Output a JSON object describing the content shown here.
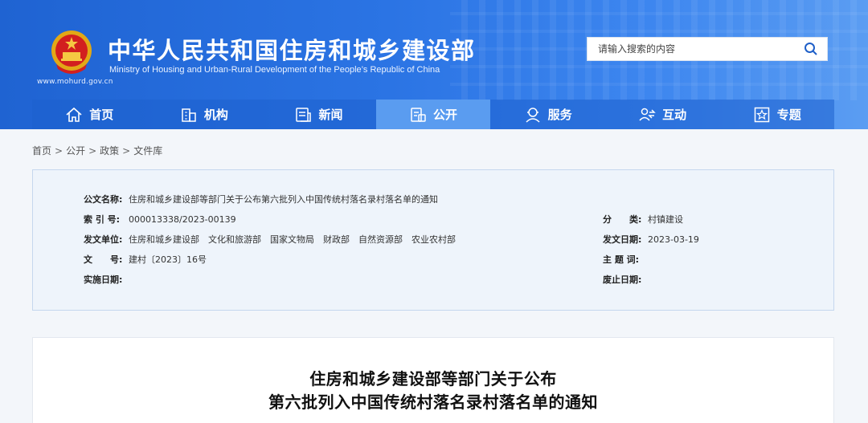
{
  "header": {
    "title_cn": "中华人民共和国住房和城乡建设部",
    "title_en": "Ministry of Housing and Urban-Rural Development of the People’s Republic of China",
    "url": "www.mohurd.gov.cn",
    "search_placeholder": "请输入搜索的内容",
    "brand_blue": "#2b74e4"
  },
  "nav": {
    "items": [
      {
        "label": "首页",
        "icon": "home-icon"
      },
      {
        "label": "机构",
        "icon": "building-icon"
      },
      {
        "label": "新闻",
        "icon": "news-icon"
      },
      {
        "label": "公开",
        "icon": "open-document-icon"
      },
      {
        "label": "服务",
        "icon": "service-icon"
      },
      {
        "label": "互动",
        "icon": "interaction-icon"
      },
      {
        "label": "专题",
        "icon": "topic-star-icon"
      }
    ],
    "active_index": 3
  },
  "breadcrumb": [
    "首页",
    "公开",
    "政策",
    "文件库"
  ],
  "info": {
    "doc_name_label": "公文名称:",
    "doc_name": "住房和城乡建设部等部门关于公布第六批列入中国传统村落名录村落名单的通知",
    "index_label": "索 引 号:",
    "index": "000013338/2023-00139",
    "category_label": "分　　类:",
    "category": "村镇建设",
    "issuer_label": "发文单位:",
    "issuer": "住房和城乡建设部　文化和旅游部　国家文物局　财政部　自然资源部　农业农村部",
    "date_label": "发文日期:",
    "date": "2023-03-19",
    "doc_no_label": "文　　号:",
    "doc_no": "建村〔2023〕16号",
    "subject_label": "主 题 词:",
    "subject": "",
    "effective_label": "实施日期:",
    "effective": "",
    "expiry_label": "废止日期:",
    "expiry": ""
  },
  "content": {
    "title_line1": "住房和城乡建设部等部门关于公布",
    "title_line2": "第六批列入中国传统村落名录村落名单的通知"
  }
}
